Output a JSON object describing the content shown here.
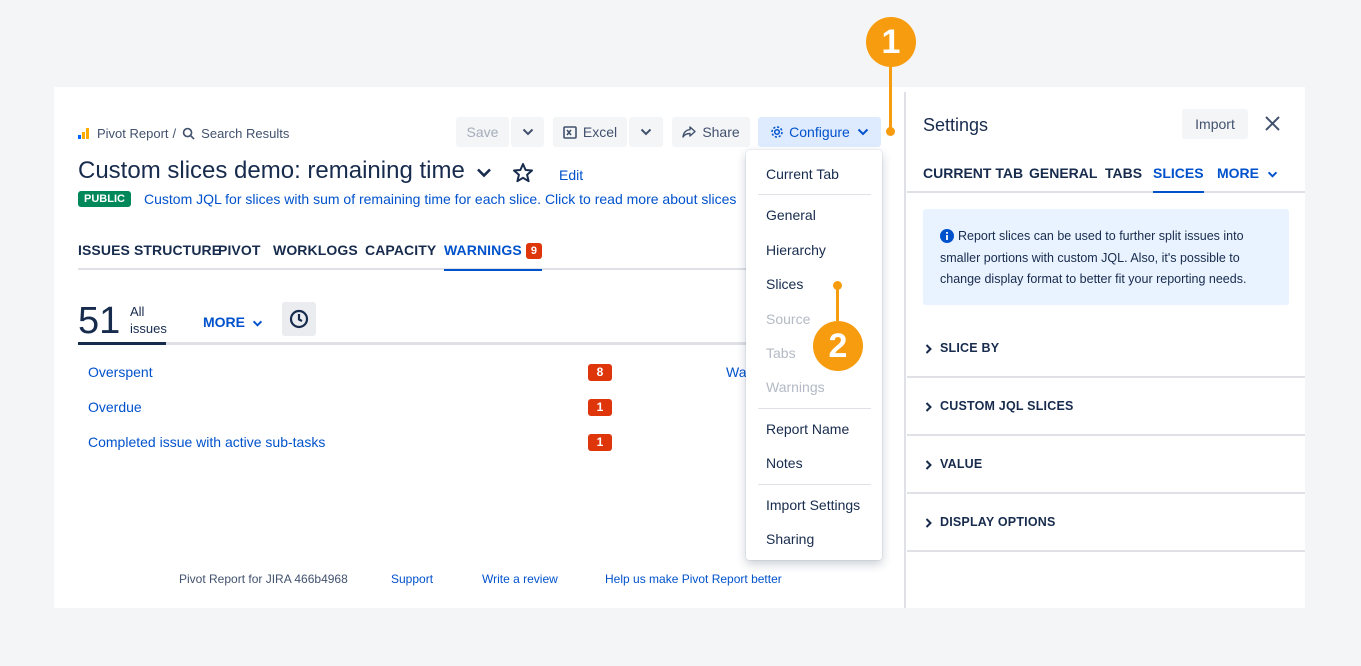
{
  "breadcrumb": {
    "app": "Pivot Report",
    "separator": "/",
    "current": "Search Results"
  },
  "toolbar": {
    "save": "Save",
    "excel": "Excel",
    "share": "Share",
    "configure": "Configure"
  },
  "report": {
    "title": "Custom slices demo: remaining time",
    "edit": "Edit",
    "visibility": "PUBLIC",
    "description": "Custom JQL for slices with sum of remaining time for each slice. Click to read more about slices"
  },
  "tabs": [
    {
      "label": "ISSUES STRUCTURE"
    },
    {
      "label": "PIVOT"
    },
    {
      "label": "WORKLOGS"
    },
    {
      "label": "CAPACITY"
    },
    {
      "label": "WARNINGS",
      "badge": "9"
    }
  ],
  "stats": {
    "count": "51",
    "label": "All issues",
    "more": "MORE"
  },
  "warnings": [
    {
      "label": "Overspent",
      "count": "8"
    },
    {
      "label": "Overdue",
      "count": "1"
    },
    {
      "label": "Completed issue with active sub-tasks",
      "count": "1"
    }
  ],
  "partial_link": "Wa",
  "footer": {
    "version": "Pivot Report for JIRA 466b4968",
    "support": "Support",
    "review": "Write a review",
    "feedback": "Help us make Pivot Report better"
  },
  "configure_menu": [
    {
      "label": "Current Tab",
      "enabled": true
    },
    {
      "label": "General",
      "enabled": true
    },
    {
      "label": "Hierarchy",
      "enabled": true
    },
    {
      "label": "Slices",
      "enabled": true
    },
    {
      "label": "Source",
      "enabled": false
    },
    {
      "label": "Tabs",
      "enabled": false
    },
    {
      "label": "Warnings",
      "enabled": false
    },
    {
      "label": "Report Name",
      "enabled": true
    },
    {
      "label": "Notes",
      "enabled": true
    },
    {
      "label": "Import Settings",
      "enabled": true
    },
    {
      "label": "Sharing",
      "enabled": true
    }
  ],
  "callouts": [
    "1",
    "2"
  ],
  "settings": {
    "title": "Settings",
    "import": "Import",
    "tabs": [
      "CURRENT TAB",
      "GENERAL",
      "TABS",
      "SLICES",
      "MORE"
    ],
    "active_tab": "SLICES",
    "info": "Report slices can be used to further split issues into smaller portions with custom JQL. Also, it's possible to change display format to better fit your reporting needs.",
    "sections": [
      "SLICE BY",
      "CUSTOM JQL SLICES",
      "VALUE",
      "DISPLAY OPTIONS"
    ]
  },
  "colors": {
    "accent": "#0052cc",
    "badge": "#de350b",
    "public": "#00875a",
    "callout": "#f79c0e",
    "info_bg": "#e9f2ff"
  }
}
